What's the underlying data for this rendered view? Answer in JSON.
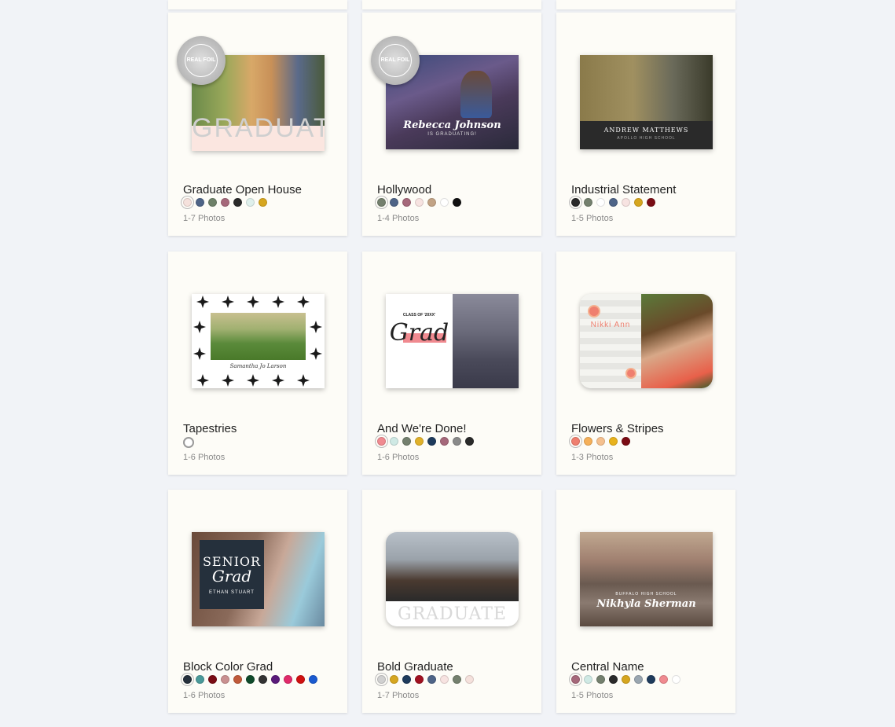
{
  "foil_badge": "REAL FOIL",
  "cards": [
    {
      "name": "Graduate Open House",
      "photos": "1-7 Photos",
      "thumb_text": "GRADUATE",
      "foil": true,
      "swatches": [
        "#f5e1dc",
        "#4e6487",
        "#6e8169",
        "#a5687a",
        "#2a2a2a",
        "#dff0ec",
        "#d6a61f"
      ]
    },
    {
      "name": "Hollywood",
      "photos": "1-4 Photos",
      "thumb_text": "Rebecca Johnson",
      "thumb_sub": "IS GRADUATING!",
      "foil": true,
      "swatches": [
        "#74806e",
        "#4e6487",
        "#a5687a",
        "#f7e3e1",
        "#c2a385",
        "#ffffff",
        "#111111"
      ]
    },
    {
      "name": "Industrial Statement",
      "photos": "1-5 Photos",
      "thumb_text": "ANDREW MATTHEWS",
      "thumb_sub": "APOLLO HIGH SCHOOL",
      "swatches": [
        "#2a2a2a",
        "#74806e",
        "#ffffff",
        "#4e6487",
        "#f7e3e1",
        "#d6a61f",
        "#7a0c14"
      ]
    },
    {
      "name": "Tapestries",
      "photos": "1-6 Photos",
      "thumb_text": "Samantha Jo Larson",
      "swatches": [
        "#ffffff"
      ]
    },
    {
      "name": "And We're Done!",
      "photos": "1-6 Photos",
      "thumb_text": "Grad",
      "thumb_sub": "CLASS OF '20XX'",
      "swatches": [
        "#f08a90",
        "#cfe9e4",
        "#74806e",
        "#e0b12a",
        "#1e3b5c",
        "#a5687a",
        "#8a8a8a",
        "#2a2a2a"
      ]
    },
    {
      "name": "Flowers & Stripes",
      "photos": "1-3 Photos",
      "thumb_text": "Nikki Ann",
      "swatches": [
        "#ef7f6f",
        "#f5b05a",
        "#f5c08e",
        "#e8b21c",
        "#7a0c14"
      ]
    },
    {
      "name": "Block Color Grad",
      "photos": "1-6 Photos",
      "thumb_text": "SENIOR",
      "thumb_sub": "Grad",
      "thumb_sub2": "ETHAN STUART",
      "swatches": [
        "#25303c",
        "#4a9a9a",
        "#7a0c14",
        "#c99090",
        "#c05a3a",
        "#0f4a2a",
        "#333333",
        "#5a1a7a",
        "#e02a6a",
        "#d01010",
        "#1a5ad0"
      ]
    },
    {
      "name": "Bold Graduate",
      "photos": "1-7 Photos",
      "thumb_text": "GRADUATE",
      "swatches": [
        "#d0d0d0",
        "#d6a61f",
        "#1e3b5c",
        "#a01020",
        "#4e6487",
        "#f7e3e1",
        "#74806e",
        "#f5e1dc"
      ]
    },
    {
      "name": "Central Name",
      "photos": "1-5 Photos",
      "thumb_text": "Nikhyla Sherman",
      "thumb_sub": "BUFFALO HIGH SCHOOL",
      "swatches": [
        "#a5687a",
        "#cfe9e4",
        "#74806e",
        "#2a2a2a",
        "#d6a61f",
        "#9aa6b0",
        "#1e3b5c",
        "#f08a90",
        "#ffffff"
      ]
    }
  ]
}
